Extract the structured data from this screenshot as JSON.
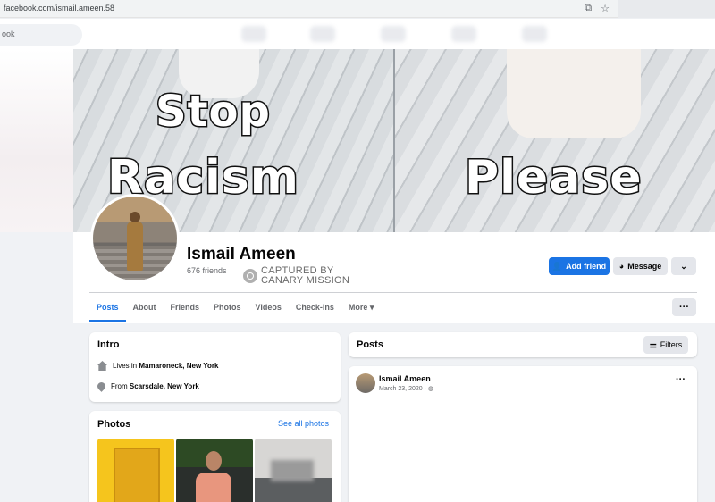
{
  "browser": {
    "url": "facebook.com/ismail.ameen.58"
  },
  "topbar": {
    "search_placeholder": "ook"
  },
  "cover": {
    "text_left_1": "Stop",
    "text_left_2": "Racism",
    "text_right": "Please"
  },
  "profile": {
    "name": "Ismail Ameen",
    "friends": "676 friends",
    "watermark_line1": "CAPTURED BY",
    "watermark_line2": "CANARY MISSION"
  },
  "actions": {
    "add_friend": "Add friend",
    "message": "Message",
    "more": "⌄"
  },
  "tabs": [
    "Posts",
    "About",
    "Friends",
    "Photos",
    "Videos",
    "Check-ins",
    "More ▾"
  ],
  "tabs_menu": "···",
  "intro": {
    "title": "Intro",
    "lives_prefix": "Lives in",
    "lives_place": "Mamaroneck, New York",
    "from_prefix": "From",
    "from_place": "Scarsdale, New York"
  },
  "photos": {
    "title": "Photos",
    "see_all": "See all photos"
  },
  "posts": {
    "title": "Posts",
    "filters": "Filters"
  },
  "post": {
    "author": "Ismail Ameen",
    "date": "March 23, 2020 · ◍",
    "menu": "···"
  },
  "colors": {
    "accent": "#1b74e4",
    "background": "#f0f2f5"
  },
  "icons": [
    "cast-icon",
    "star-icon",
    "user-plus-icon",
    "messenger-icon",
    "chevron-down-icon",
    "house-icon",
    "location-pin-icon",
    "filters-icon",
    "more-dots-icon"
  ]
}
